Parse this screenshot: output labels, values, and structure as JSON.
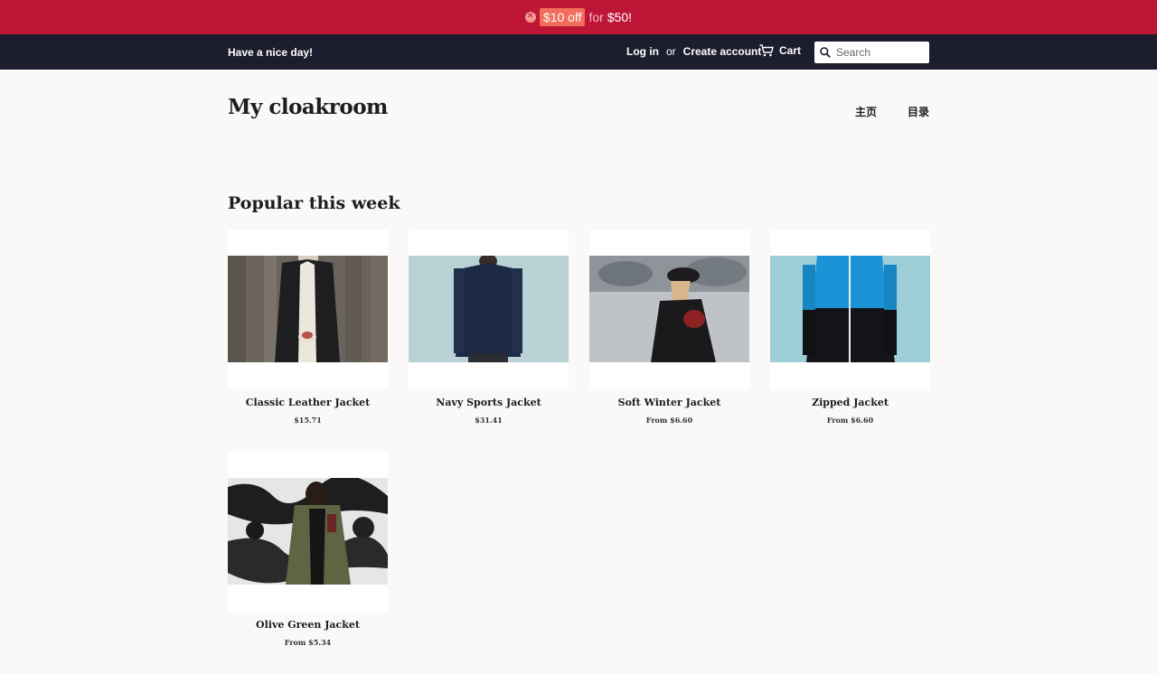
{
  "promo": {
    "discount": "$10 off",
    "for_text": "for",
    "amount": "$50!"
  },
  "topbar": {
    "greeting": "Have a nice day!",
    "login": "Log in",
    "or": "or",
    "create_account": "Create account",
    "cart": "Cart",
    "search_placeholder": "Search"
  },
  "header": {
    "logo": "My cloakroom",
    "nav": [
      "主页",
      "目录"
    ]
  },
  "section_title": "Popular this week",
  "products": [
    {
      "name": "Classic Leather Jacket",
      "price": "$15.71"
    },
    {
      "name": "Navy Sports Jacket",
      "price": "$31.41"
    },
    {
      "name": "Soft Winter Jacket",
      "price": "From $6.60"
    },
    {
      "name": "Zipped Jacket",
      "price": "From $6.60"
    },
    {
      "name": "Olive Green Jacket",
      "price": "From $5.34"
    }
  ],
  "colors": {
    "promo_bg": "#be1637",
    "topbar_bg": "#1c1d2e",
    "badge": "#f26d5b"
  }
}
